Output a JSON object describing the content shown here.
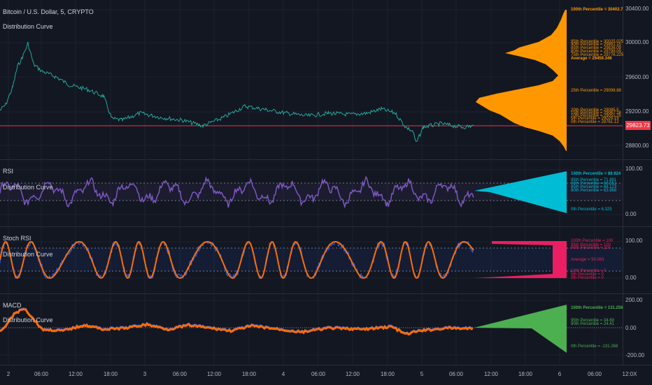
{
  "chart": {
    "symbol_title": "Bitcoin / U.S. Dollar, 5, CRYPTO",
    "indicator_label": "Distribution Curve",
    "last_price": "29823.73"
  },
  "panes": [
    {
      "name": "price",
      "title": "Bitcoin / U.S. Dollar, 5, CRYPTO",
      "price_ticks": [
        "30400.00",
        "30000.00",
        "29600.00",
        "29200.00",
        "28800.00"
      ],
      "stats_color": "#ff9800",
      "stats": [
        {
          "text": "100th Percentile = 30402.7",
          "level": 0.5,
          "bold": true
        },
        {
          "text": "95th Percentile = 30025.025",
          "level": 0.76
        },
        {
          "text": "90th Percentile = 29891.15",
          "level": 0.79
        },
        {
          "text": "85th Percentile = 29836.09",
          "level": 0.82
        },
        {
          "text": "80th Percentile = 29799.09",
          "level": 0.845
        },
        {
          "text": "75th Percentile = 29776.225",
          "level": 0.87
        },
        {
          "text": "Average = 29459.346",
          "level": 0.5,
          "bold": true
        },
        {
          "text": "25th Percentile = 29098.88",
          "level": 0.74
        },
        {
          "text": "20th Percentile = 29085.5",
          "level": 0.755
        },
        {
          "text": "15th Percentile = 29067.16",
          "level": 0.77
        },
        {
          "text": "10th Percentile = 29051.25",
          "level": 0.785
        },
        {
          "text": "5th Percentile = 29029.19",
          "level": 0.8
        },
        {
          "text": "0th Percentile = 28761.12",
          "level": 0.5
        }
      ]
    },
    {
      "name": "rsi",
      "title": "RSI",
      "price_ticks": [
        "100.00",
        "0.00"
      ],
      "stats_color": "#00bcd4",
      "stats": [
        {
          "text": "100th Percentile = 88.924",
          "bold": true
        },
        {
          "text": "95th Percentile = 71.891"
        },
        {
          "text": "90th Percentile = 68.551"
        },
        {
          "text": "85th Percentile = 66.123"
        },
        {
          "text": "80th Percentile = 63.968"
        },
        {
          "text": "0th Percentile = 6.325"
        }
      ]
    },
    {
      "name": "stoch",
      "title": "Stoch RSI",
      "price_ticks": [
        "100.00",
        "0.00"
      ],
      "stats_color": "#e91e63",
      "stats": [
        {
          "text": "100th Percentile = 100"
        },
        {
          "text": "95th Percentile = 100"
        },
        {
          "text": "90th Percentile = 100"
        },
        {
          "text": "Average = 50.063"
        },
        {
          "text": "10th Percentile = 0"
        },
        {
          "text": "5th Percentile = 0"
        },
        {
          "text": "0th Percentile = 0"
        }
      ]
    },
    {
      "name": "macd",
      "title": "MACD",
      "price_ticks": [
        "200.00",
        "0.00",
        "-200.00"
      ],
      "stats_color": "#4caf50",
      "stats": [
        {
          "text": "100th Percentile = 131.256",
          "bold": true
        },
        {
          "text": "95th Percentile = 34.69"
        },
        {
          "text": "90th Percentile = 24.41"
        },
        {
          "text": "0th Percentile = -131.268"
        }
      ]
    }
  ],
  "time_axis": [
    "2",
    "06:00",
    "12:00",
    "18:00",
    "3",
    "06:00",
    "12:00",
    "18:00",
    "4",
    "06:00",
    "12:00",
    "18:00",
    "5",
    "06:00",
    "12:00",
    "18:00",
    "6",
    "06:00",
    "12:0X"
  ],
  "colors": {
    "price_line_up": "#26a69a",
    "price_line_down": "#ef5350",
    "rsi_line": "#7e57c2",
    "stoch_k": "#2962ff",
    "stoch_d": "#ff6d00",
    "macd_line": "#2962ff",
    "signal_line": "#ff6d00",
    "histogram": "#f23645",
    "last_price_line": "#f23645"
  }
}
